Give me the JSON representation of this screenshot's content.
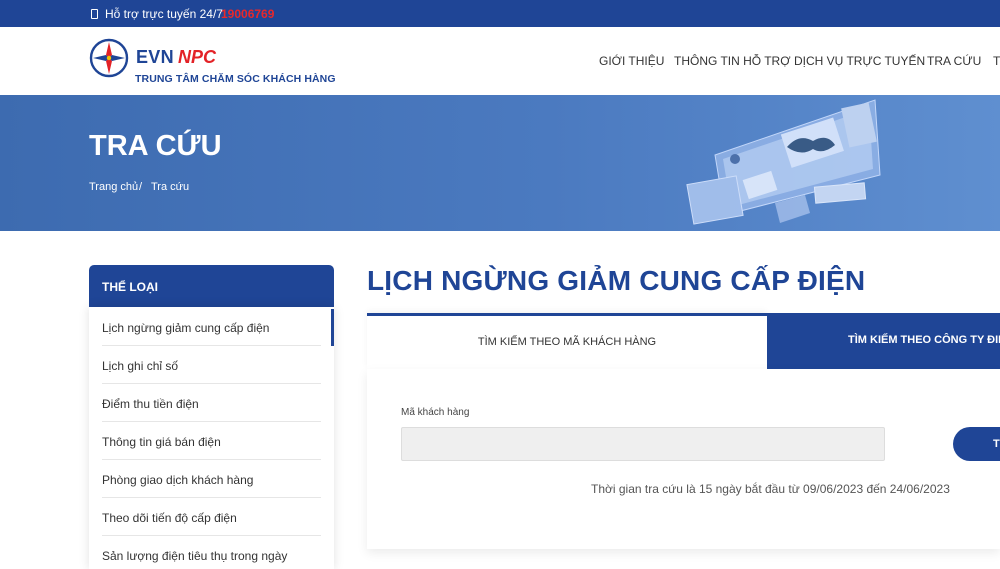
{
  "topbar": {
    "support_label": "Hỗ trợ trực tuyến 24/7:",
    "hotline": "19006769"
  },
  "brand": {
    "evn": "EVN",
    "npc": "NPC",
    "subtitle": "TRUNG TÂM CHĂM SÓC KHÁCH HÀNG"
  },
  "nav": {
    "items": [
      {
        "label": "GIỚI THIỆU"
      },
      {
        "label": "THÔNG TIN HỖ TRỢ"
      },
      {
        "label": "DỊCH VỤ TRỰC TUYẾN"
      },
      {
        "label": "TRA CỨU"
      },
      {
        "label": "T"
      }
    ]
  },
  "banner": {
    "title": "TRA CỨU",
    "breadcrumb": {
      "home": "Trang chủ",
      "separator": "/",
      "current": "Tra cứu"
    }
  },
  "sidebar": {
    "heading": "THỂ LOẠI",
    "items": [
      {
        "label": "Lịch ngừng giảm cung cấp điện",
        "active": true
      },
      {
        "label": "Lịch ghi chỉ số"
      },
      {
        "label": "Điểm thu tiền điện"
      },
      {
        "label": "Thông tin giá bán điện"
      },
      {
        "label": "Phòng giao dịch khách hàng"
      },
      {
        "label": "Theo dõi tiến độ cấp điện"
      },
      {
        "label": "Sản lượng điện tiêu thụ trong ngày"
      }
    ]
  },
  "main": {
    "title": "LỊCH NGỪNG GIẢM CUNG CẤP ĐIỆN",
    "tabs": [
      {
        "label": "TÌM KIẾM THEO MÃ KHÁCH HÀNG"
      },
      {
        "label": "TÌM KIẾM THEO CÔNG TY ĐIỆN"
      }
    ],
    "form": {
      "field_label": "Mã khách hàng",
      "field_value": "",
      "field_placeholder": "",
      "button_label": "T",
      "note": "Thời gian tra cứu là 15 ngày bắt đầu từ 09/06/2023 đến 24/06/2023"
    }
  },
  "colors": {
    "primary": "#1f4596",
    "accent_red": "#e32227",
    "banner": "#4b7ac0"
  }
}
